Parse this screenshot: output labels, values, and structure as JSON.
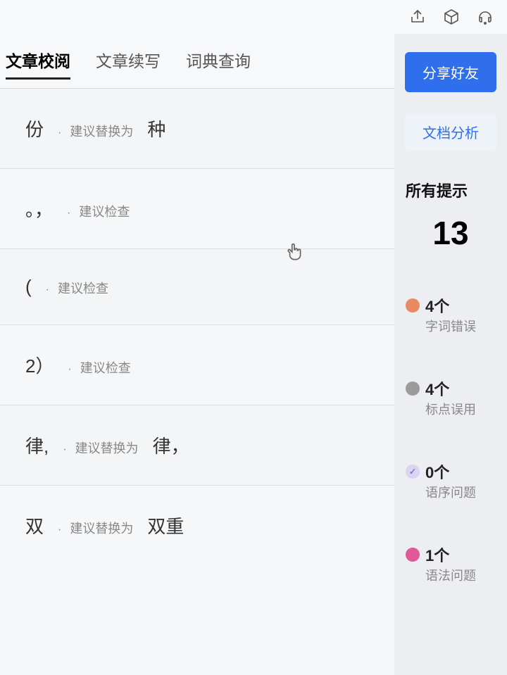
{
  "topbar": {
    "share_icon": "share",
    "cube_icon": "cube",
    "headset_icon": "headset"
  },
  "tabs": [
    {
      "label": "文章校阅",
      "active": true
    },
    {
      "label": "文章续写",
      "active": false
    },
    {
      "label": "词典查询",
      "active": false
    }
  ],
  "suggestions": [
    {
      "original": "份",
      "hint": "建议替换为",
      "replacement": "种"
    },
    {
      "original": "。，",
      "hint": "建议检查",
      "replacement": ""
    },
    {
      "original": "(",
      "hint": "建议检查",
      "replacement": ""
    },
    {
      "original": "2）",
      "hint": "建议检查",
      "replacement": ""
    },
    {
      "original": "律,",
      "hint": "建议替换为",
      "replacement": "律，"
    },
    {
      "original": "双",
      "hint": "建议替换为",
      "replacement": "双重"
    }
  ],
  "sidebar": {
    "share_btn": "分享好友",
    "analyze_btn": "文档分析",
    "all_hints_title": "所有提示",
    "total_count": "13",
    "categories": [
      {
        "color": "#e98a63",
        "count": "4个",
        "label": "字词错误",
        "check": false
      },
      {
        "color": "#9b9b9b",
        "count": "4个",
        "label": "标点误用",
        "check": false
      },
      {
        "color": "#cfc7ec",
        "count": "0个",
        "label": "语序问题",
        "check": true
      },
      {
        "color": "#e05a9a",
        "count": "1个",
        "label": "语法问题",
        "check": false
      }
    ]
  }
}
